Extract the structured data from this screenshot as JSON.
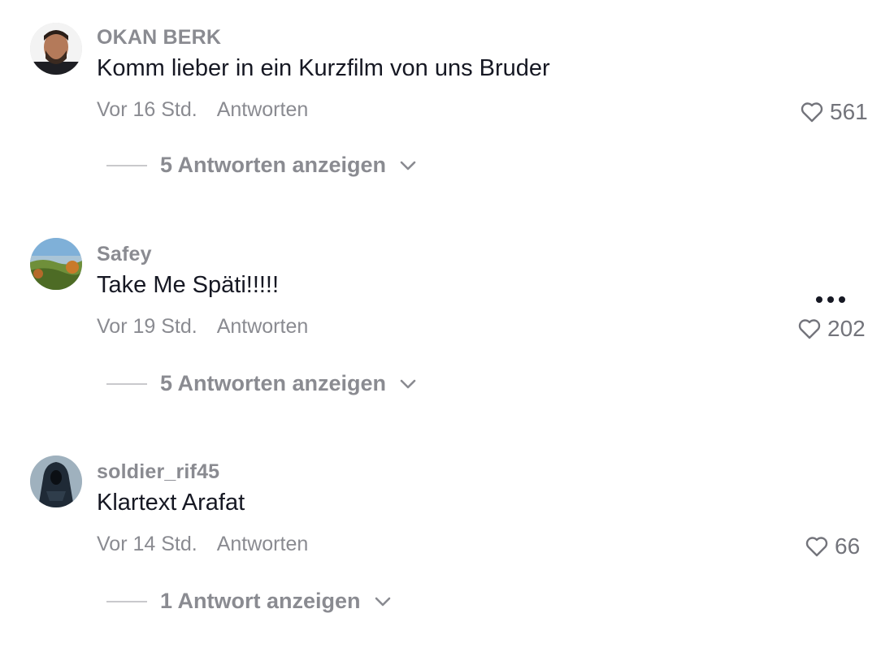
{
  "comments": [
    {
      "username": "OKAN BERK",
      "text": "Komm lieber in ein Kurzfilm von uns Bruder",
      "time": "Vor 16 Std.",
      "reply_label": "Antworten",
      "likes": "561",
      "view_replies": "5 Antworten anzeigen",
      "avatar": "man-portrait"
    },
    {
      "username": "Safey",
      "text": "Take Me Späti!!!!!",
      "time": "Vor 19 Std.",
      "reply_label": "Antworten",
      "likes": "202",
      "view_replies": "5 Antworten anzeigen",
      "avatar": "landscape"
    },
    {
      "username": "soldier_rif45",
      "text": "Klartext Arafat",
      "time": "Vor 14 Std.",
      "reply_label": "Antworten",
      "likes": "66",
      "view_replies": "1 Antwort anzeigen",
      "avatar": "hooded-figure"
    }
  ],
  "icons": {
    "like": "heart-outline-icon",
    "more": "more-horizontal-icon",
    "expand": "chevron-down-icon"
  },
  "colors": {
    "muted_text": "#8a8b91",
    "primary_text": "#161823"
  }
}
